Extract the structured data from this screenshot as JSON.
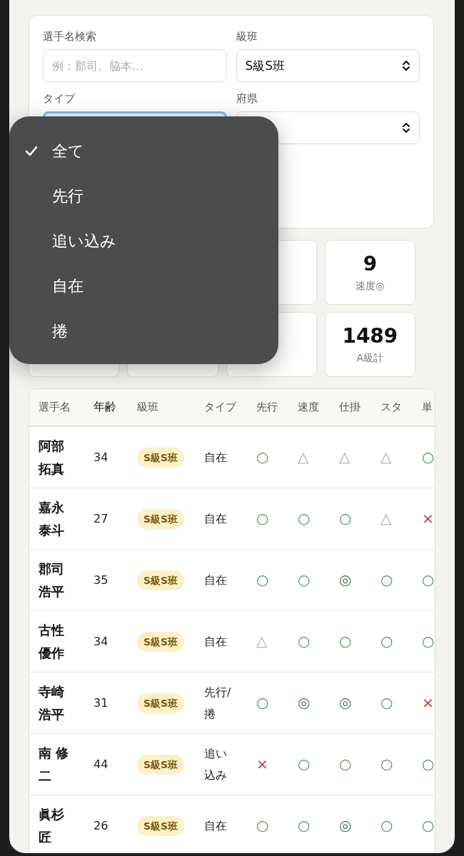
{
  "filters": {
    "name_search": {
      "label": "選手名検索",
      "placeholder": "例：郡司、脇本..."
    },
    "grade": {
      "label": "級班",
      "value": "S級S班"
    },
    "type": {
      "label": "タイプ"
    },
    "prefecture": {
      "label": "府県"
    }
  },
  "type_menu": [
    {
      "label": "全て",
      "selected": true
    },
    {
      "label": "先行",
      "selected": false
    },
    {
      "label": "追い込み",
      "selected": false
    },
    {
      "label": "自在",
      "selected": false
    },
    {
      "label": "捲",
      "selected": false
    }
  ],
  "stats": [
    {
      "value": "9",
      "label": "速度◎"
    },
    {
      "value": "1489",
      "label": "A級計"
    }
  ],
  "table": {
    "columns": [
      "選手名",
      "年齢",
      "級班",
      "タイプ",
      "先行",
      "速度",
      "仕掛",
      "スタ",
      "単"
    ],
    "rows": [
      {
        "name": "阿部拓真",
        "age": "34",
        "grade": "S級S班",
        "type": "自在",
        "marks": [
          {
            "kind": "good",
            "text": "○"
          },
          {
            "kind": "fair",
            "text": "△"
          },
          {
            "kind": "fair",
            "text": "△"
          },
          {
            "kind": "fair",
            "text": "△"
          },
          {
            "kind": "good",
            "text": "○"
          }
        ]
      },
      {
        "name": "嘉永泰斗",
        "age": "27",
        "grade": "S級S班",
        "type": "自在",
        "marks": [
          {
            "kind": "good",
            "text": "○"
          },
          {
            "kind": "good",
            "text": "○"
          },
          {
            "kind": "good",
            "text": "○"
          },
          {
            "kind": "fair",
            "text": "△"
          },
          {
            "kind": "bad",
            "text": "×"
          }
        ]
      },
      {
        "name": "郡司浩平",
        "age": "35",
        "grade": "S級S班",
        "type": "自在",
        "marks": [
          {
            "kind": "good",
            "text": "○"
          },
          {
            "kind": "good",
            "text": "○"
          },
          {
            "kind": "best",
            "text": "◎"
          },
          {
            "kind": "good",
            "text": "○"
          },
          {
            "kind": "good",
            "text": "○"
          }
        ]
      },
      {
        "name": "古性優作",
        "age": "34",
        "grade": "S級S班",
        "type": "自在",
        "marks": [
          {
            "kind": "fair",
            "text": "△"
          },
          {
            "kind": "good",
            "text": "○"
          },
          {
            "kind": "good",
            "text": "○"
          },
          {
            "kind": "good",
            "text": "○"
          },
          {
            "kind": "good",
            "text": "○"
          }
        ]
      },
      {
        "name": "寺崎浩平",
        "age": "31",
        "grade": "S級S班",
        "type": "先行/捲",
        "marks": [
          {
            "kind": "good",
            "text": "○"
          },
          {
            "kind": "best",
            "text": "◎"
          },
          {
            "kind": "best",
            "text": "◎"
          },
          {
            "kind": "good",
            "text": "○"
          },
          {
            "kind": "bad",
            "text": "×"
          }
        ]
      },
      {
        "name": "南 修二",
        "age": "44",
        "grade": "S級S班",
        "type": "追い込み",
        "marks": [
          {
            "kind": "bad",
            "text": "×"
          },
          {
            "kind": "good",
            "text": "○"
          },
          {
            "kind": "good",
            "text": "○"
          },
          {
            "kind": "good",
            "text": "○"
          },
          {
            "kind": "good",
            "text": "○"
          }
        ]
      },
      {
        "name": "眞杉匠",
        "age": "26",
        "grade": "S級S班",
        "type": "自在",
        "marks": [
          {
            "kind": "good",
            "text": "○"
          },
          {
            "kind": "good",
            "text": "○"
          },
          {
            "kind": "best",
            "text": "◎"
          },
          {
            "kind": "good",
            "text": "○"
          },
          {
            "kind": "good",
            "text": "○"
          }
        ]
      }
    ]
  }
}
